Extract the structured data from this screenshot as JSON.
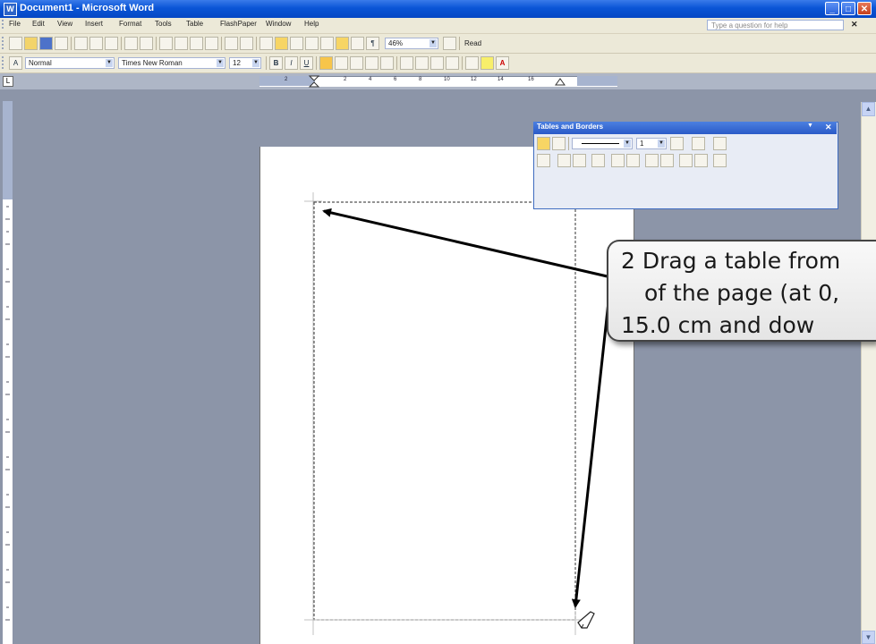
{
  "window": {
    "title": "Document1 - Microsoft Word",
    "icon_text": "W",
    "minimize_glyph": "_",
    "maximize_glyph": "□",
    "close_glyph": "✕"
  },
  "menu": {
    "items": [
      "File",
      "Edit",
      "View",
      "Insert",
      "Format",
      "Tools",
      "Table",
      "FlashPaper",
      "Window",
      "Help"
    ],
    "help_placeholder": "Type a question for help",
    "close_glyph": "✕"
  },
  "standard_toolbar": {
    "zoom": "46%",
    "read_label": "Read"
  },
  "formatting_toolbar": {
    "style": "Normal",
    "font": "Times New Roman",
    "size": "12",
    "bold": "B",
    "italic": "I",
    "underline": "U"
  },
  "ruler": {
    "tab_selector_glyph": "L",
    "ticks": [
      "2",
      "2",
      "4",
      "6",
      "8",
      "10",
      "12",
      "14",
      "16"
    ]
  },
  "tables_and_borders": {
    "title": "Tables and Borders",
    "line_weight": "1",
    "dropdown_glyph": "▼",
    "close_glyph": "✕"
  },
  "callout": {
    "lines": [
      "2 Drag a table from",
      "of the page (at 0,",
      "15.0 cm and dow"
    ]
  },
  "scrollbar": {
    "up_glyph": "▲",
    "down_glyph": "▼"
  },
  "colors": {
    "title_bar": "#0a55d6",
    "app_background": "#8c95a8",
    "toolbar_background": "#ece9d8",
    "arrow": "#000000"
  }
}
